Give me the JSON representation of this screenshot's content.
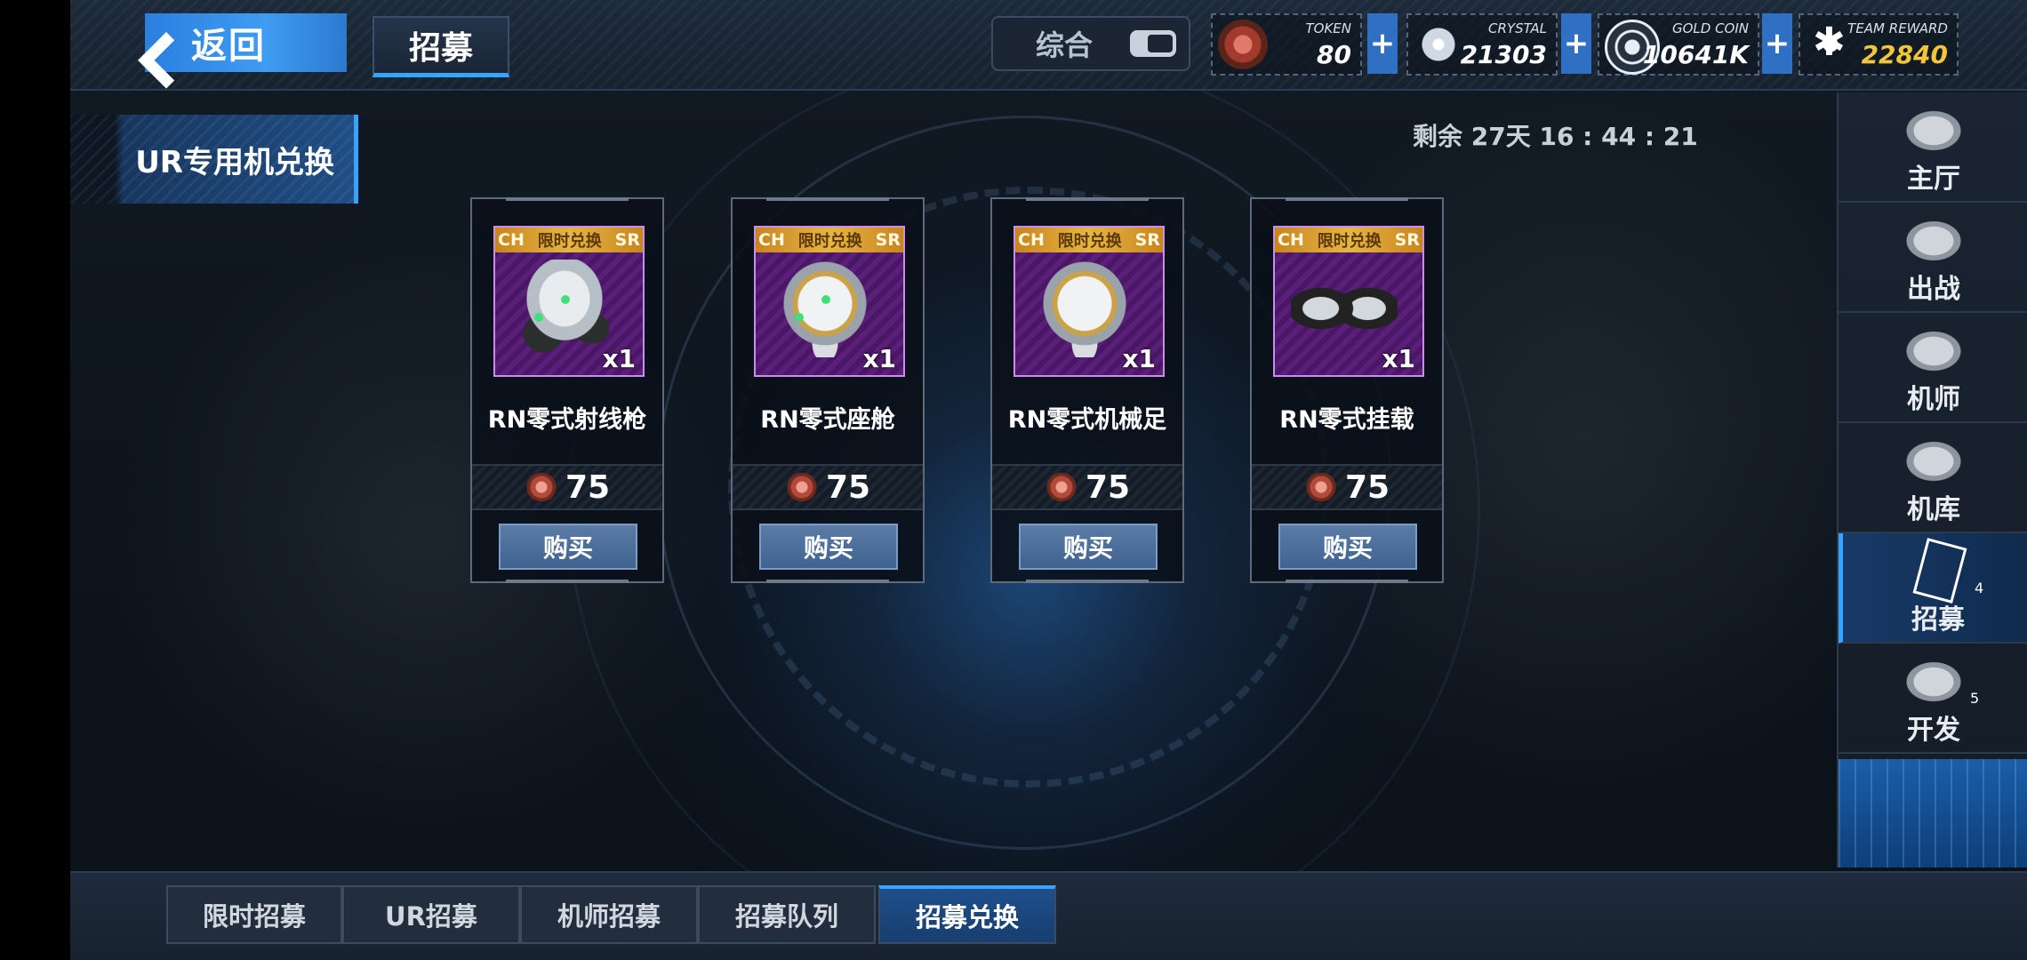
{
  "header": {
    "back_label": "返回",
    "title": "招募",
    "filter_label": "综合",
    "resources": [
      {
        "name": "TOKEN",
        "value": "80",
        "icon": "token-icon"
      },
      {
        "name": "CRYSTAL",
        "value": "21303",
        "icon": "crystal-icon"
      },
      {
        "name": "GOLD COIN",
        "value": "10641K",
        "icon": "gold-coin-icon"
      },
      {
        "name": "TEAM REWARD",
        "value": "22840",
        "icon": "team-reward-icon",
        "color": "#f2c63a"
      }
    ],
    "plus_glyph": "+"
  },
  "category": {
    "label": "UR专用机兑换"
  },
  "timer": "剩余 27天 16 : 44 : 21",
  "items": [
    {
      "name": "RN零式射线枪",
      "banner_left": "CH",
      "banner_mid": "限时兑换",
      "banner_right": "SR",
      "qty": "x1",
      "price": "75",
      "buy_label": "购买"
    },
    {
      "name": "RN零式座舱",
      "banner_left": "CH",
      "banner_mid": "限时兑换",
      "banner_right": "SR",
      "qty": "x1",
      "price": "75",
      "buy_label": "购买"
    },
    {
      "name": "RN零式机械足",
      "banner_left": "CH",
      "banner_mid": "限时兑换",
      "banner_right": "SR",
      "qty": "x1",
      "price": "75",
      "buy_label": "购买"
    },
    {
      "name": "RN零式挂载",
      "banner_left": "CH",
      "banner_mid": "限时兑换",
      "banner_right": "SR",
      "qty": "x1",
      "price": "75",
      "buy_label": "购买"
    }
  ],
  "sidebar": {
    "items": [
      {
        "label": "主厅",
        "icon": "hall-icon"
      },
      {
        "label": "出战",
        "icon": "sortie-icon"
      },
      {
        "label": "机师",
        "icon": "pilot-icon"
      },
      {
        "label": "机库",
        "icon": "hangar-icon"
      },
      {
        "label": "招募",
        "icon": "recruit-card-icon",
        "badge": "4",
        "active": true
      },
      {
        "label": "开发",
        "icon": "develop-icon",
        "badge": "5"
      }
    ]
  },
  "bottom_tabs": [
    {
      "label": "限时招募"
    },
    {
      "label": "UR招募"
    },
    {
      "label": "机师招募"
    },
    {
      "label": "招募队列"
    },
    {
      "label": "招募兑换",
      "active": true
    }
  ],
  "colors": {
    "accent": "#39a4ff",
    "back_button": "#3f9cf2",
    "rarity_frame": "#c98fe8",
    "banner": "#e6b543"
  }
}
